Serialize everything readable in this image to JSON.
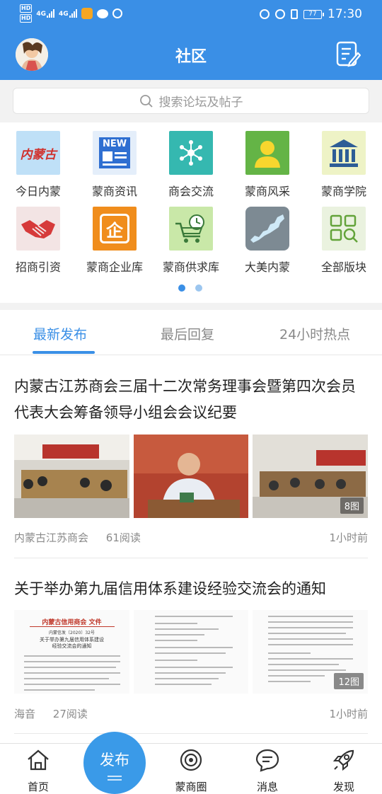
{
  "status_bar": {
    "hd1": "HD",
    "hd2": "HD",
    "net1": "4G",
    "net2": "4G",
    "battery": "77",
    "time": "17:30"
  },
  "header": {
    "title": "社区"
  },
  "search": {
    "placeholder": "搜索论坛及帖子"
  },
  "categories": [
    {
      "label": "今日内蒙",
      "icon": "inner-mongolia-logo-icon",
      "icon_text": "内蒙古"
    },
    {
      "label": "蒙商资讯",
      "icon": "newspaper-icon",
      "icon_text": "NEW"
    },
    {
      "label": "商会交流",
      "icon": "network-nodes-icon"
    },
    {
      "label": "蒙商风采",
      "icon": "person-icon"
    },
    {
      "label": "蒙商学院",
      "icon": "building-columns-icon"
    },
    {
      "label": "招商引资",
      "icon": "handshake-icon"
    },
    {
      "label": "蒙商企业库",
      "icon": "enterprise-icon",
      "icon_text": "企"
    },
    {
      "label": "蒙商供求库",
      "icon": "shopping-cart-clock-icon"
    },
    {
      "label": "大美内蒙",
      "icon": "map-icon"
    },
    {
      "label": "全部版块",
      "icon": "grid-search-icon"
    }
  ],
  "tabs": [
    {
      "label": "最新发布",
      "active": true
    },
    {
      "label": "最后回复",
      "active": false
    },
    {
      "label": "24小时热点",
      "active": false
    }
  ],
  "posts": [
    {
      "title": "内蒙古江苏商会三届十二次常务理事会暨第四次会员代表大会筹备领导小组会会议纪要",
      "author": "内蒙古江苏商会",
      "reads": "61阅读",
      "time": "1小时前",
      "image_count": "8图"
    },
    {
      "title": "关于举办第九届信用体系建设经验交流会的通知",
      "author": "海音",
      "reads": "27阅读",
      "time": "1小时前",
      "image_count": "12图",
      "doc_header": "内蒙古信用商会",
      "doc_mark": "文件",
      "doc_no": "内蒙信发〔2020〕32号",
      "doc_title_line1": "关于举办第九届信用体系建设",
      "doc_title_line2": "经验交流会的通知"
    }
  ],
  "bottom_nav": [
    {
      "label": "首页",
      "icon": "home-icon"
    },
    {
      "label": "发布",
      "icon": "publish-icon"
    },
    {
      "label": "蒙商圈",
      "icon": "circle-icon"
    },
    {
      "label": "消息",
      "icon": "message-icon"
    },
    {
      "label": "发现",
      "icon": "rocket-icon"
    }
  ],
  "colors": {
    "brand_blue": "#3a8fe6",
    "tab_active": "#3a8fe6",
    "publish_button": "#3a9ae8"
  }
}
